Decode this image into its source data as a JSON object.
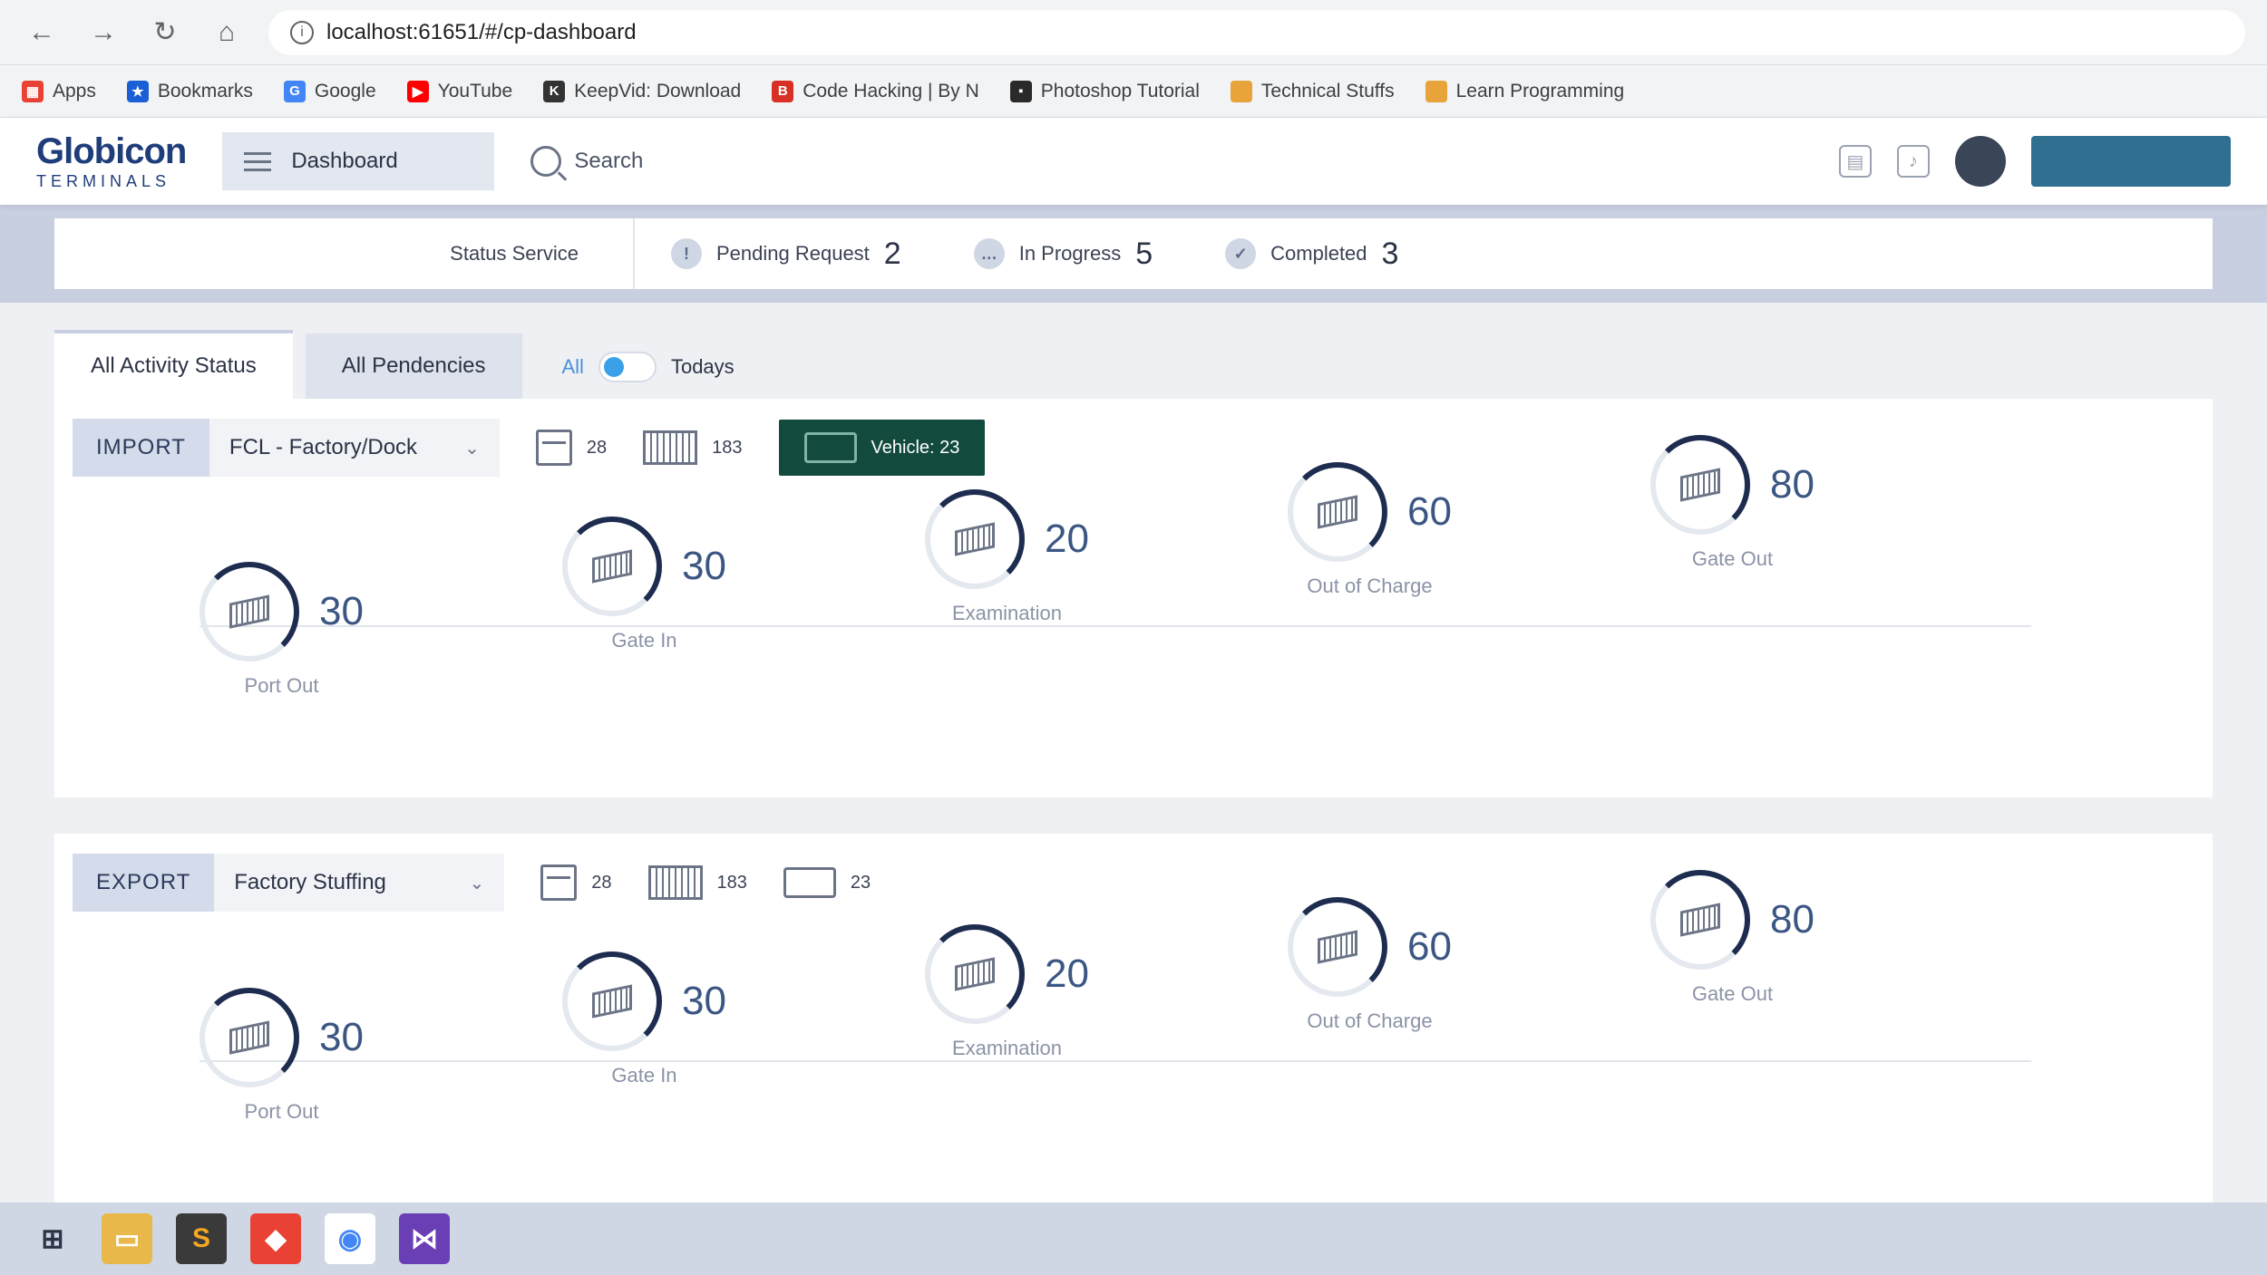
{
  "browser": {
    "url": "localhost:61651/#/cp-dashboard",
    "bookmarks": [
      "Apps",
      "Bookmarks",
      "Google",
      "YouTube",
      "KeepVid: Download",
      "Code Hacking | By N",
      "Photoshop Tutorial",
      "Technical Stuffs",
      "Learn Programming"
    ]
  },
  "header": {
    "logo_line1": "Globicon",
    "logo_line2": "TERMINALS",
    "menu_label": "Dashboard",
    "search_label": "Search"
  },
  "status": {
    "service_label": "Status Service",
    "pending_label": "Pending Request",
    "pending_count": "2",
    "progress_label": "In Progress",
    "progress_count": "5",
    "completed_label": "Completed",
    "completed_count": "3"
  },
  "tabs": {
    "activity": "All Activity Status",
    "pendencies": "All Pendencies",
    "toggle_all": "All",
    "toggle_todays": "Todays"
  },
  "import": {
    "tag": "IMPORT",
    "mode": "FCL - Factory/Dock",
    "count_box": "28",
    "count_container": "183",
    "vehicle_label": "Vehicle: 23",
    "stages": [
      {
        "label": "Port Out",
        "value": "30"
      },
      {
        "label": "Gate In",
        "value": "30"
      },
      {
        "label": "Examination",
        "value": "20"
      },
      {
        "label": "Out of Charge",
        "value": "60"
      },
      {
        "label": "Gate Out",
        "value": "80"
      }
    ]
  },
  "export": {
    "tag": "EXPORT",
    "mode": "Factory Stuffing",
    "count_box": "28",
    "count_container": "183",
    "count_vehicle": "23",
    "stages": [
      {
        "label": "Port Out",
        "value": "30"
      },
      {
        "label": "Gate In",
        "value": "30"
      },
      {
        "label": "Examination",
        "value": "20"
      },
      {
        "label": "Out of Charge",
        "value": "60"
      },
      {
        "label": "Gate Out",
        "value": "80"
      }
    ]
  }
}
